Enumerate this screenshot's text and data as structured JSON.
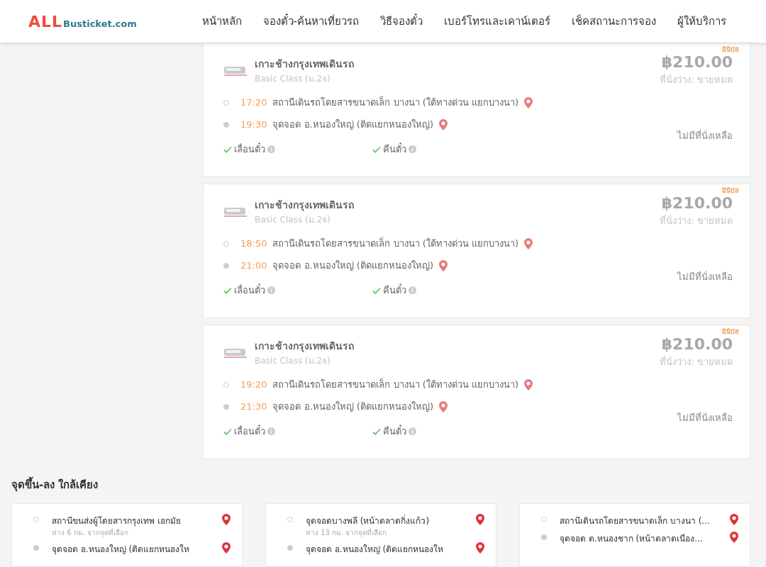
{
  "header": {
    "logo": {
      "primary": "ALL",
      "secondary": "Busticket.com"
    },
    "nav": [
      {
        "label": "หน้าหลัก"
      },
      {
        "label": "จองตั๋ว-ค้นหาเที่ยวรถ"
      },
      {
        "label": "วิธีจองตั๋ว"
      },
      {
        "label": "เบอร์โทรและเคาน์เตอร์"
      },
      {
        "label": "เช็คสถานะการจอง"
      },
      {
        "label": "ผู้ให้บริการ"
      }
    ]
  },
  "trips": [
    {
      "badge": "มินิบัส",
      "operator": "เกาะช้างกรุงเทพเดินรถ",
      "bus_class": "Basic Class (ม.2จ)",
      "price": "฿210.00",
      "seats": "ที่นั่งว่าง: ขายหมด",
      "status": "ไม่มีที่นั่งเหลือ",
      "stops": [
        {
          "time": "17:20",
          "name": "สถานีเดินรถโดยสารขนาดเล็ก บางนา (ใต้ทางด่วน แยกบางนา)"
        },
        {
          "time": "19:30",
          "name": "จุดจอด อ.หนองใหญ่ (ติดแยกหนองใหญ่)"
        }
      ],
      "features": [
        {
          "label": "เลื่อนตั๋ว",
          "available": true
        },
        {
          "label": "คืนตั๋ว",
          "available": true
        }
      ]
    },
    {
      "badge": "มินิบัส",
      "operator": "เกาะช้างกรุงเทพเดินรถ",
      "bus_class": "Basic Class (ม.2จ)",
      "price": "฿210.00",
      "seats": "ที่นั่งว่าง: ขายหมด",
      "status": "ไม่มีที่นั่งเหลือ",
      "stops": [
        {
          "time": "18:50",
          "name": "สถานีเดินรถโดยสารขนาดเล็ก บางนา (ใต้ทางด่วน แยกบางนา)"
        },
        {
          "time": "21:00",
          "name": "จุดจอด อ.หนองใหญ่ (ติดแยกหนองใหญ่)"
        }
      ],
      "features": [
        {
          "label": "เลื่อนตั๋ว",
          "available": true
        },
        {
          "label": "คืนตั๋ว",
          "available": true
        }
      ]
    },
    {
      "badge": "มินิบัส",
      "operator": "เกาะช้างกรุงเทพเดินรถ",
      "bus_class": "Basic Class (ม.2จ)",
      "price": "฿210.00",
      "seats": "ที่นั่งว่าง: ขายหมด",
      "status": "ไม่มีที่นั่งเหลือ",
      "stops": [
        {
          "time": "19:20",
          "name": "สถานีเดินรถโดยสารขนาดเล็ก บางนา (ใต้ทางด่วน แยกบางนา)"
        },
        {
          "time": "21:30",
          "name": "จุดจอด อ.หนองใหญ่ (ติดแยกหนองใหญ่)"
        }
      ],
      "features": [
        {
          "label": "เลื่อนตั๋ว",
          "available": true
        },
        {
          "label": "คืนตั๋ว",
          "available": true
        }
      ]
    }
  ],
  "nearby": {
    "title": "จุดขึ้น-ลง ใกล้เคียง",
    "cards": [
      {
        "stops": [
          {
            "name": "สถานีขนส่งผู้โดยสารกรุงเทพ เอกมัย",
            "distance": "ห่าง 6 กม. จากจุดที่เลือก"
          },
          {
            "name": "จุดจอด อ.หนองใหญ่ (ติดแยกหนองให"
          }
        ]
      },
      {
        "stops": [
          {
            "name": "จุดจอดบางพลี (หน้าตลาดกิ่งแก้ว)",
            "distance": "ห่าง 13 กม. จากจุดที่เลือก"
          },
          {
            "name": "จุดจอด อ.หนองใหญ่ (ติดแยกหนองให"
          }
        ]
      },
      {
        "stops": [
          {
            "name": "สถานีเดินรถโดยสารขนาดเล็ก บางนา (..."
          },
          {
            "name": "จุดจอด ต.หนองชาก (หน้าตลาดเนือง..."
          }
        ]
      }
    ]
  }
}
